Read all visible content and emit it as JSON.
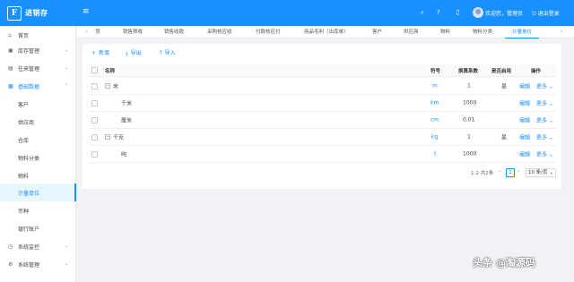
{
  "app": {
    "logo_mark": "F",
    "title": "进销存"
  },
  "topbar": {
    "menu_icon": "≡",
    "search_icon": "⌕",
    "help_icon": "?",
    "bell_icon": "♫",
    "welcome": "欢迎您，管理员",
    "logout": "退出登录",
    "logout_icon": "⎋"
  },
  "sidebar": {
    "items": [
      {
        "icon": "⌂",
        "label": "首页",
        "chevron": ""
      },
      {
        "icon": "▣",
        "label": "库存管理",
        "chevron": "⌄"
      },
      {
        "icon": "▤",
        "label": "往来管理",
        "chevron": "⌄"
      },
      {
        "icon": "▦",
        "label": "基础数据",
        "chevron": "⌃"
      },
      {
        "icon": "",
        "label": "客户",
        "chevron": ""
      },
      {
        "icon": "",
        "label": "供应商",
        "chevron": ""
      },
      {
        "icon": "",
        "label": "仓库",
        "chevron": ""
      },
      {
        "icon": "",
        "label": "物料分类",
        "chevron": ""
      },
      {
        "icon": "",
        "label": "物料",
        "chevron": ""
      },
      {
        "icon": "",
        "label": "计量单位",
        "chevron": ""
      },
      {
        "icon": "",
        "label": "币种",
        "chevron": ""
      },
      {
        "icon": "",
        "label": "银行账户",
        "chevron": ""
      },
      {
        "icon": "◷",
        "label": "系统监控",
        "chevron": "⌄"
      },
      {
        "icon": "⚙",
        "label": "系统管理",
        "chevron": "⌄"
      }
    ]
  },
  "tabs": {
    "prev_arrow": "‹",
    "next_arrow": "›",
    "items": [
      "顶",
      "销售预收",
      "销售收款",
      "采购核应收",
      "付款核应付",
      "商品毛利（出库单）",
      "客户",
      "供应商",
      "物料",
      "物料分类",
      "计量单位"
    ]
  },
  "toolbar": {
    "add": {
      "icon": "+",
      "label": "新增"
    },
    "export": {
      "icon": "⤓",
      "label": "导出"
    },
    "import": {
      "icon": "⤒",
      "label": "导入"
    }
  },
  "table": {
    "headers": {
      "name": "名称",
      "symbol": "符号",
      "ratio": "换算系数",
      "is_default": "是否启用",
      "ops": "操作"
    },
    "rows": [
      {
        "expand": "−",
        "name": "米",
        "symbol": "m",
        "ratio": "1",
        "is_default": "是",
        "edit": "编辑",
        "more": "更多 ⌄"
      },
      {
        "expand": "",
        "name": "千米",
        "symbol": "km",
        "ratio": "1000",
        "is_default": "",
        "edit": "编辑",
        "more": "更多 ⌄"
      },
      {
        "expand": "",
        "name": "厘米",
        "symbol": "cm",
        "ratio": "0.01",
        "is_default": "",
        "edit": "编辑",
        "more": "更多 ⌄"
      },
      {
        "expand": "−",
        "name": "千克",
        "symbol": "kg",
        "ratio": "1",
        "is_default": "是",
        "edit": "编辑",
        "more": "更多 ⌄"
      },
      {
        "expand": "",
        "name": "吨",
        "symbol": "t",
        "ratio": "1000",
        "is_default": "",
        "edit": "编辑",
        "more": "更多 ⌄"
      }
    ]
  },
  "pager": {
    "total": "1-2 共2条",
    "prev": "‹",
    "page": "1",
    "next": "›",
    "size": "10 条/页 ⌄"
  },
  "watermark": "头条 @淘源码"
}
